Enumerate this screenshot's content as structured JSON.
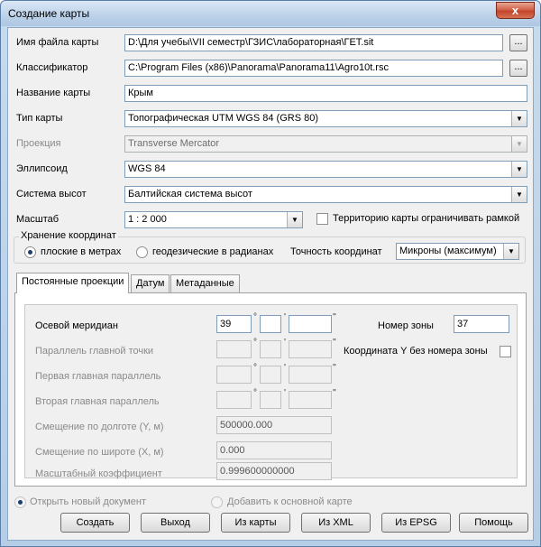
{
  "window": {
    "title": "Создание карты",
    "close_label": "x"
  },
  "fields": {
    "filename": {
      "label": "Имя файла карты",
      "value": "D:\\Для учебы\\VII семестр\\ГЗИС\\лабораторная\\ГЕТ.sit",
      "browse": "..."
    },
    "classifier": {
      "label": "Классификатор",
      "value": "C:\\Program Files (x86)\\Panorama\\Panorama11\\Agro10t.rsc",
      "browse": "..."
    },
    "map_name": {
      "label": "Название карты",
      "value": "Крым"
    },
    "map_type": {
      "label": "Тип карты",
      "value": "Топографическая UTM WGS 84 (GRS 80)"
    },
    "projection": {
      "label": "Проекция",
      "value": "Transverse Mercator"
    },
    "ellipsoid": {
      "label": "Эллипсоид",
      "value": "WGS 84"
    },
    "height_system": {
      "label": "Система высот",
      "value": "Балтийская система высот"
    },
    "scale": {
      "label": "Масштаб",
      "value": "1 : 2 000"
    },
    "frame_check": {
      "label": "Территорию карты ограничивать рамкой"
    }
  },
  "coord_storage": {
    "group_title": "Хранение координат",
    "radio_flat": "плоские в метрах",
    "radio_geo": "геодезические в радианах",
    "precision_label": "Точность координат",
    "precision_value": "Микроны (максимум)"
  },
  "tabs": [
    {
      "label": "Постоянные проекции"
    },
    {
      "label": "Датум"
    },
    {
      "label": "Метаданные"
    }
  ],
  "projection_params": {
    "central_meridian": {
      "label": "Осевой меридиан",
      "deg": "39",
      "min": "",
      "sec": ""
    },
    "main_point_parallel": {
      "label": "Параллель главной точки"
    },
    "first_parallel": {
      "label": "Первая главная параллель"
    },
    "second_parallel": {
      "label": "Вторая главная параллель"
    },
    "false_easting": {
      "label": "Смещение по долготе (Y, м)",
      "value": "500000.000"
    },
    "false_northing": {
      "label": "Смещение по широте (X, м)",
      "value": "0.000"
    },
    "scale_factor": {
      "label": "Масштабный коэффициент",
      "value": "0.999600000000"
    },
    "zone": {
      "label": "Номер зоны",
      "value": "37"
    },
    "y_no_zone": {
      "label": "Координата Y  без номера зоны"
    },
    "symbols": {
      "deg": "°",
      "min": "'",
      "sec": "''"
    }
  },
  "bottom_options": {
    "open_new": "Открыть новый документ",
    "add_to_main": "Добавить к основной карте"
  },
  "buttons": {
    "create": "Создать",
    "exit": "Выход",
    "from_map": "Из карты",
    "from_xml": "Из XML",
    "from_epsg": "Из EPSG",
    "help": "Помощь"
  },
  "icons": {
    "dropdown": "chevron-down-icon",
    "close": "close-icon"
  }
}
